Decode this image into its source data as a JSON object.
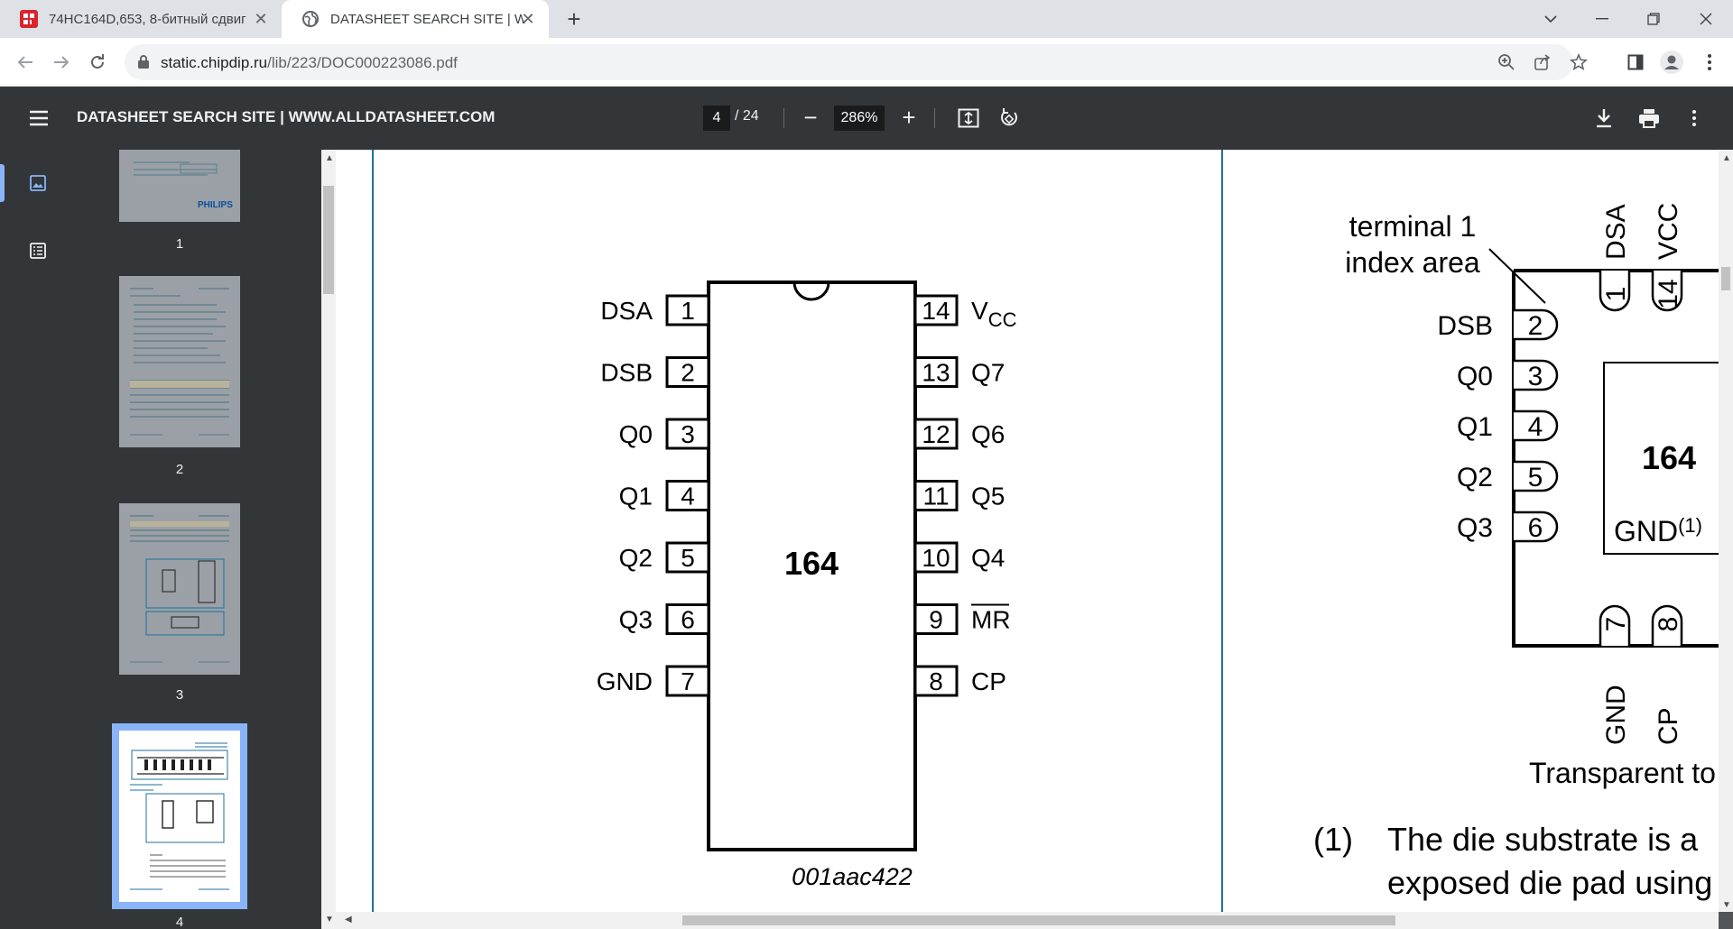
{
  "browser": {
    "tabs": [
      {
        "title": "74HC164D,653, 8-битный сдвиг",
        "close": "✕"
      },
      {
        "title": "DATASHEET SEARCH SITE | WWW",
        "close": "✕"
      }
    ],
    "new_tab": "+",
    "url_host": "static.chipdip.ru",
    "url_path": "/lib/223/DOC000223086.pdf"
  },
  "pdf_toolbar": {
    "title": "DATASHEET SEARCH SITE | WWW.ALLDATASHEET.COM",
    "current_page": "4",
    "total_pages": "/ 24",
    "zoom": "286%",
    "zoom_out": "−",
    "zoom_in": "+"
  },
  "sidebar": {
    "thumbnails": [
      {
        "label": "1",
        "logo": "PHILIPS"
      },
      {
        "label": "2"
      },
      {
        "label": "3"
      },
      {
        "label": "4"
      }
    ]
  },
  "document": {
    "dip_package": {
      "chip_label": "164",
      "figure_id": "001aac422",
      "left_pins": [
        {
          "num": "1",
          "name": "DSA"
        },
        {
          "num": "2",
          "name": "DSB"
        },
        {
          "num": "3",
          "name": "Q0"
        },
        {
          "num": "4",
          "name": "Q1"
        },
        {
          "num": "5",
          "name": "Q2"
        },
        {
          "num": "6",
          "name": "Q3"
        },
        {
          "num": "7",
          "name": "GND"
        }
      ],
      "right_pins": [
        {
          "num": "14",
          "name": "V",
          "sub": "CC"
        },
        {
          "num": "13",
          "name": "Q7"
        },
        {
          "num": "12",
          "name": "Q6"
        },
        {
          "num": "11",
          "name": "Q5"
        },
        {
          "num": "10",
          "name": "Q4"
        },
        {
          "num": "9",
          "name": "MR",
          "overline": true
        },
        {
          "num": "8",
          "name": "CP"
        }
      ]
    },
    "dhvqfn_package": {
      "index_label_line1": "terminal 1",
      "index_label_line2": "index area",
      "chip_label": "164",
      "gnd_label": "GND",
      "gnd_note": "(1)",
      "top_pins": [
        {
          "num": "1",
          "name": "DSA"
        },
        {
          "num": "14",
          "name": "VCC"
        }
      ],
      "left_pins": [
        {
          "num": "2",
          "name": "DSB"
        },
        {
          "num": "3",
          "name": "Q0"
        },
        {
          "num": "4",
          "name": "Q1"
        },
        {
          "num": "5",
          "name": "Q2"
        },
        {
          "num": "6",
          "name": "Q3"
        }
      ],
      "bottom_pins": [
        {
          "num": "7",
          "name": "GND"
        },
        {
          "num": "8",
          "name": "CP"
        }
      ],
      "caption": "Transparent to",
      "note_num": "(1)",
      "note_line1": "The die substrate is a",
      "note_line2": "exposed die pad using"
    }
  }
}
